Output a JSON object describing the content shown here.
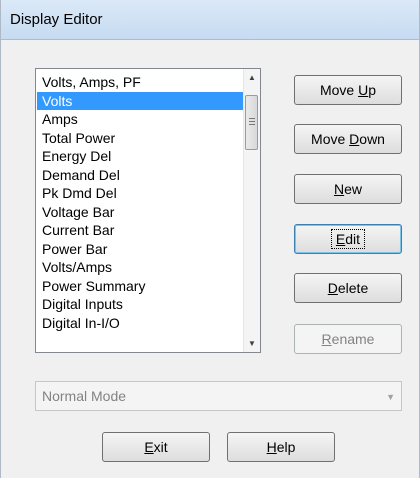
{
  "window": {
    "title": "Display Editor"
  },
  "list": {
    "selected_index": 1,
    "items": [
      "Volts, Amps, PF",
      "Volts",
      "Amps",
      "Total Power",
      "Energy Del",
      "Demand Del",
      "Pk Dmd Del",
      "Voltage Bar",
      "Current Bar",
      "Power Bar",
      "Volts/Amps",
      "Power Summary",
      "Digital Inputs",
      "Digital In-I/O"
    ]
  },
  "buttons": {
    "move_up": {
      "pre": "Move ",
      "key": "U",
      "post": "p"
    },
    "move_down": {
      "pre": "Move ",
      "key": "D",
      "post": "own"
    },
    "new": {
      "pre": "",
      "key": "N",
      "post": "ew"
    },
    "edit": {
      "pre": "",
      "key": "E",
      "post": "dit"
    },
    "delete": {
      "pre": "",
      "key": "D",
      "post": "elete"
    },
    "rename": {
      "pre": "",
      "key": "R",
      "post": "ename"
    },
    "exit": {
      "pre": "",
      "key": "E",
      "post": "xit"
    },
    "help": {
      "pre": "",
      "key": "H",
      "post": "elp"
    }
  },
  "mode_select": {
    "value": "Normal Mode"
  }
}
